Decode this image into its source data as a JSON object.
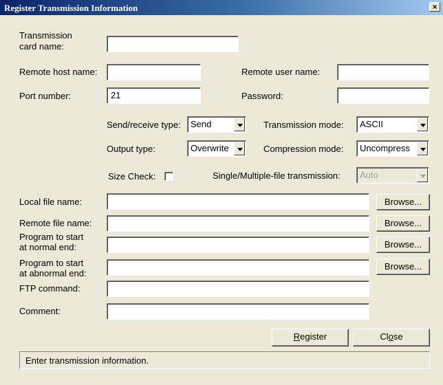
{
  "window": {
    "title": "Register Transmission Information",
    "close_label": "×"
  },
  "form": {
    "card_name": {
      "label_line1": "Transmission",
      "label_line2": "card name:",
      "value": ""
    },
    "remote_host": {
      "label": "Remote host name:",
      "value": ""
    },
    "remote_user": {
      "label": "Remote user name:",
      "value": ""
    },
    "port": {
      "label": "Port number:",
      "value": "21"
    },
    "password": {
      "label": "Password:",
      "value": ""
    },
    "send_receive": {
      "label": "Send/receive type:",
      "value": "Send"
    },
    "transmission_mode": {
      "label": "Transmission mode:",
      "value": "ASCII"
    },
    "output_type": {
      "label": "Output type:",
      "value": "Overwrite"
    },
    "compression_mode": {
      "label": "Compression mode:",
      "value": "Uncompress"
    },
    "size_check": {
      "label": "Size Check:",
      "checked": false
    },
    "single_multiple": {
      "label": "Single/Multiple-file transmission:",
      "value": "Auto",
      "disabled": true
    },
    "local_file": {
      "label": "Local file name:",
      "value": "",
      "browse": "Browse..."
    },
    "remote_file": {
      "label": "Remote file name:",
      "value": "",
      "browse": "Browse..."
    },
    "normal_end": {
      "label_line1": "Program to start",
      "label_line2": "at normal end:",
      "value": "",
      "browse": "Browse..."
    },
    "abnormal_end": {
      "label_line1": "Program to start",
      "label_line2": "at abnormal end:",
      "value": "",
      "browse": "Browse..."
    },
    "ftp_command": {
      "label": "FTP command:",
      "value": ""
    },
    "comment": {
      "label": "Comment:",
      "value": ""
    }
  },
  "buttons": {
    "register_accel": "R",
    "register_rest": "egister",
    "close_pre": "Cl",
    "close_accel": "o",
    "close_rest": "se"
  },
  "status": {
    "text": "Enter transmission information."
  }
}
